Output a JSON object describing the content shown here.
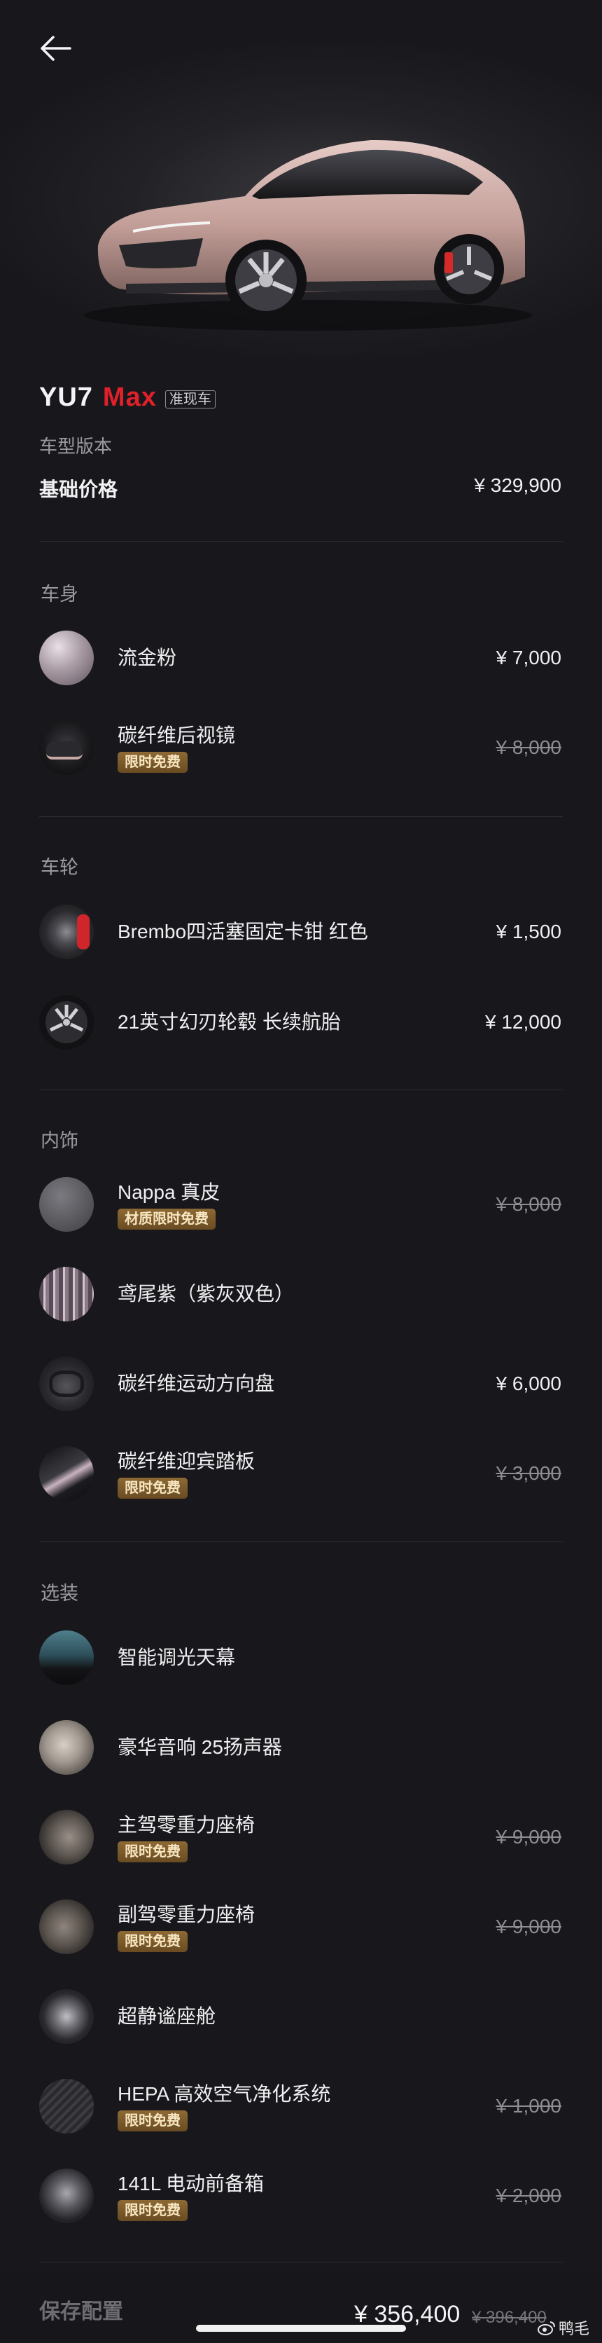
{
  "header": {
    "back_icon": "arrow-left-icon"
  },
  "vehicle": {
    "model": "YU7",
    "suffix": "Max",
    "badge": "准现车",
    "version_label": "车型版本",
    "base_price_label": "基础价格",
    "base_price": "¥ 329,900"
  },
  "sections": [
    {
      "title": "车身",
      "items": [
        {
          "name": "流金粉",
          "price": "¥ 7,000"
        },
        {
          "name": "碳纤维后视镜",
          "tag": "限时免费",
          "price": "¥ 8,000",
          "struck": true
        }
      ]
    },
    {
      "title": "车轮",
      "items": [
        {
          "name": "Brembo四活塞固定卡钳 红色",
          "price": "¥ 1,500"
        },
        {
          "name": "21英寸幻刃轮毂 长续航胎",
          "price": "¥ 12,000"
        }
      ]
    },
    {
      "title": "内饰",
      "items": [
        {
          "name": "Nappa 真皮",
          "tag": "材质限时免费",
          "price": "¥ 8,000",
          "struck": true
        },
        {
          "name": "鸢尾紫（紫灰双色）"
        },
        {
          "name": "碳纤维运动方向盘",
          "price": "¥ 6,000"
        },
        {
          "name": "碳纤维迎宾踏板",
          "tag": "限时免费",
          "price": "¥ 3,000",
          "struck": true
        }
      ]
    },
    {
      "title": "选装",
      "items": [
        {
          "name": "智能调光天幕"
        },
        {
          "name": "豪华音响 25扬声器"
        },
        {
          "name": "主驾零重力座椅",
          "tag": "限时免费",
          "price": "¥ 9,000",
          "struck": true
        },
        {
          "name": "副驾零重力座椅",
          "tag": "限时免费",
          "price": "¥ 9,000",
          "struck": true
        },
        {
          "name": "超静谧座舱"
        },
        {
          "name": "HEPA 高效空气净化系统",
          "tag": "限时免费",
          "price": "¥ 1,000",
          "struck": true
        },
        {
          "name": "141L 电动前备箱",
          "tag": "限时免费",
          "price": "¥ 2,000",
          "struck": true
        }
      ]
    }
  ],
  "footer": {
    "left_text": "保存配置",
    "total": "¥ 356,400",
    "original_total": "¥ 396,400",
    "watermark": "鸭毛",
    "watermark_icon": "weibo-logo-icon"
  }
}
